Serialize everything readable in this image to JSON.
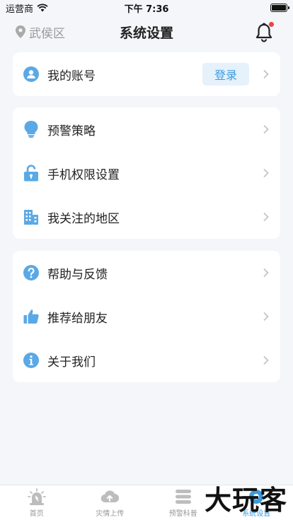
{
  "status_bar": {
    "carrier": "运营商",
    "time": "下午 7:36"
  },
  "header": {
    "location": "武侯区",
    "title": "系统设置"
  },
  "account": {
    "label": "我的账号",
    "login_label": "登录"
  },
  "group1": [
    {
      "label": "预警策略",
      "icon": "lightbulb-icon"
    },
    {
      "label": "手机权限设置",
      "icon": "lock-icon"
    },
    {
      "label": "我关注的地区",
      "icon": "building-icon"
    }
  ],
  "group2": [
    {
      "label": "帮助与反馈",
      "icon": "question-icon"
    },
    {
      "label": "推荐给朋友",
      "icon": "thumbs-up-icon"
    },
    {
      "label": "关于我们",
      "icon": "info-icon"
    }
  ],
  "tabs": [
    {
      "label": "首页",
      "icon": "alarm-icon"
    },
    {
      "label": "灾情上传",
      "icon": "cloud-upload-icon"
    },
    {
      "label": "预警科普",
      "icon": "stack-icon"
    },
    {
      "label": "系统设置",
      "icon": "settings-icon",
      "active": true
    }
  ],
  "watermark": "大玩客",
  "colors": {
    "accent": "#3a9be0",
    "background": "#f4f6f9",
    "badge": "#f04040",
    "inactive": "#999999"
  }
}
